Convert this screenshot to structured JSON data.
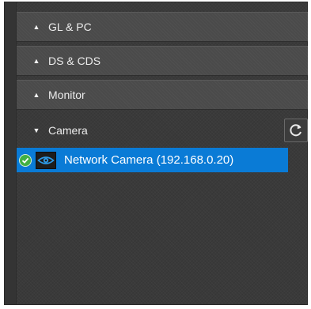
{
  "panel": {
    "sections": [
      {
        "label": "GL & PC",
        "expanded": false
      },
      {
        "label": "DS & CDS",
        "expanded": false
      },
      {
        "label": "Monitor",
        "expanded": false
      }
    ],
    "camera": {
      "label": "Camera",
      "expanded": true,
      "refresh_icon": "refresh-icon",
      "devices": [
        {
          "label": "Network Camera (192.168.0.20)",
          "status": "connected",
          "selected": true
        }
      ]
    }
  },
  "colors": {
    "panel_bg": "#3a3a3a",
    "section_bg": "#4a4a4a",
    "selection": "#0a7bd6",
    "status_ok": "#41b043",
    "text": "#ececec"
  }
}
